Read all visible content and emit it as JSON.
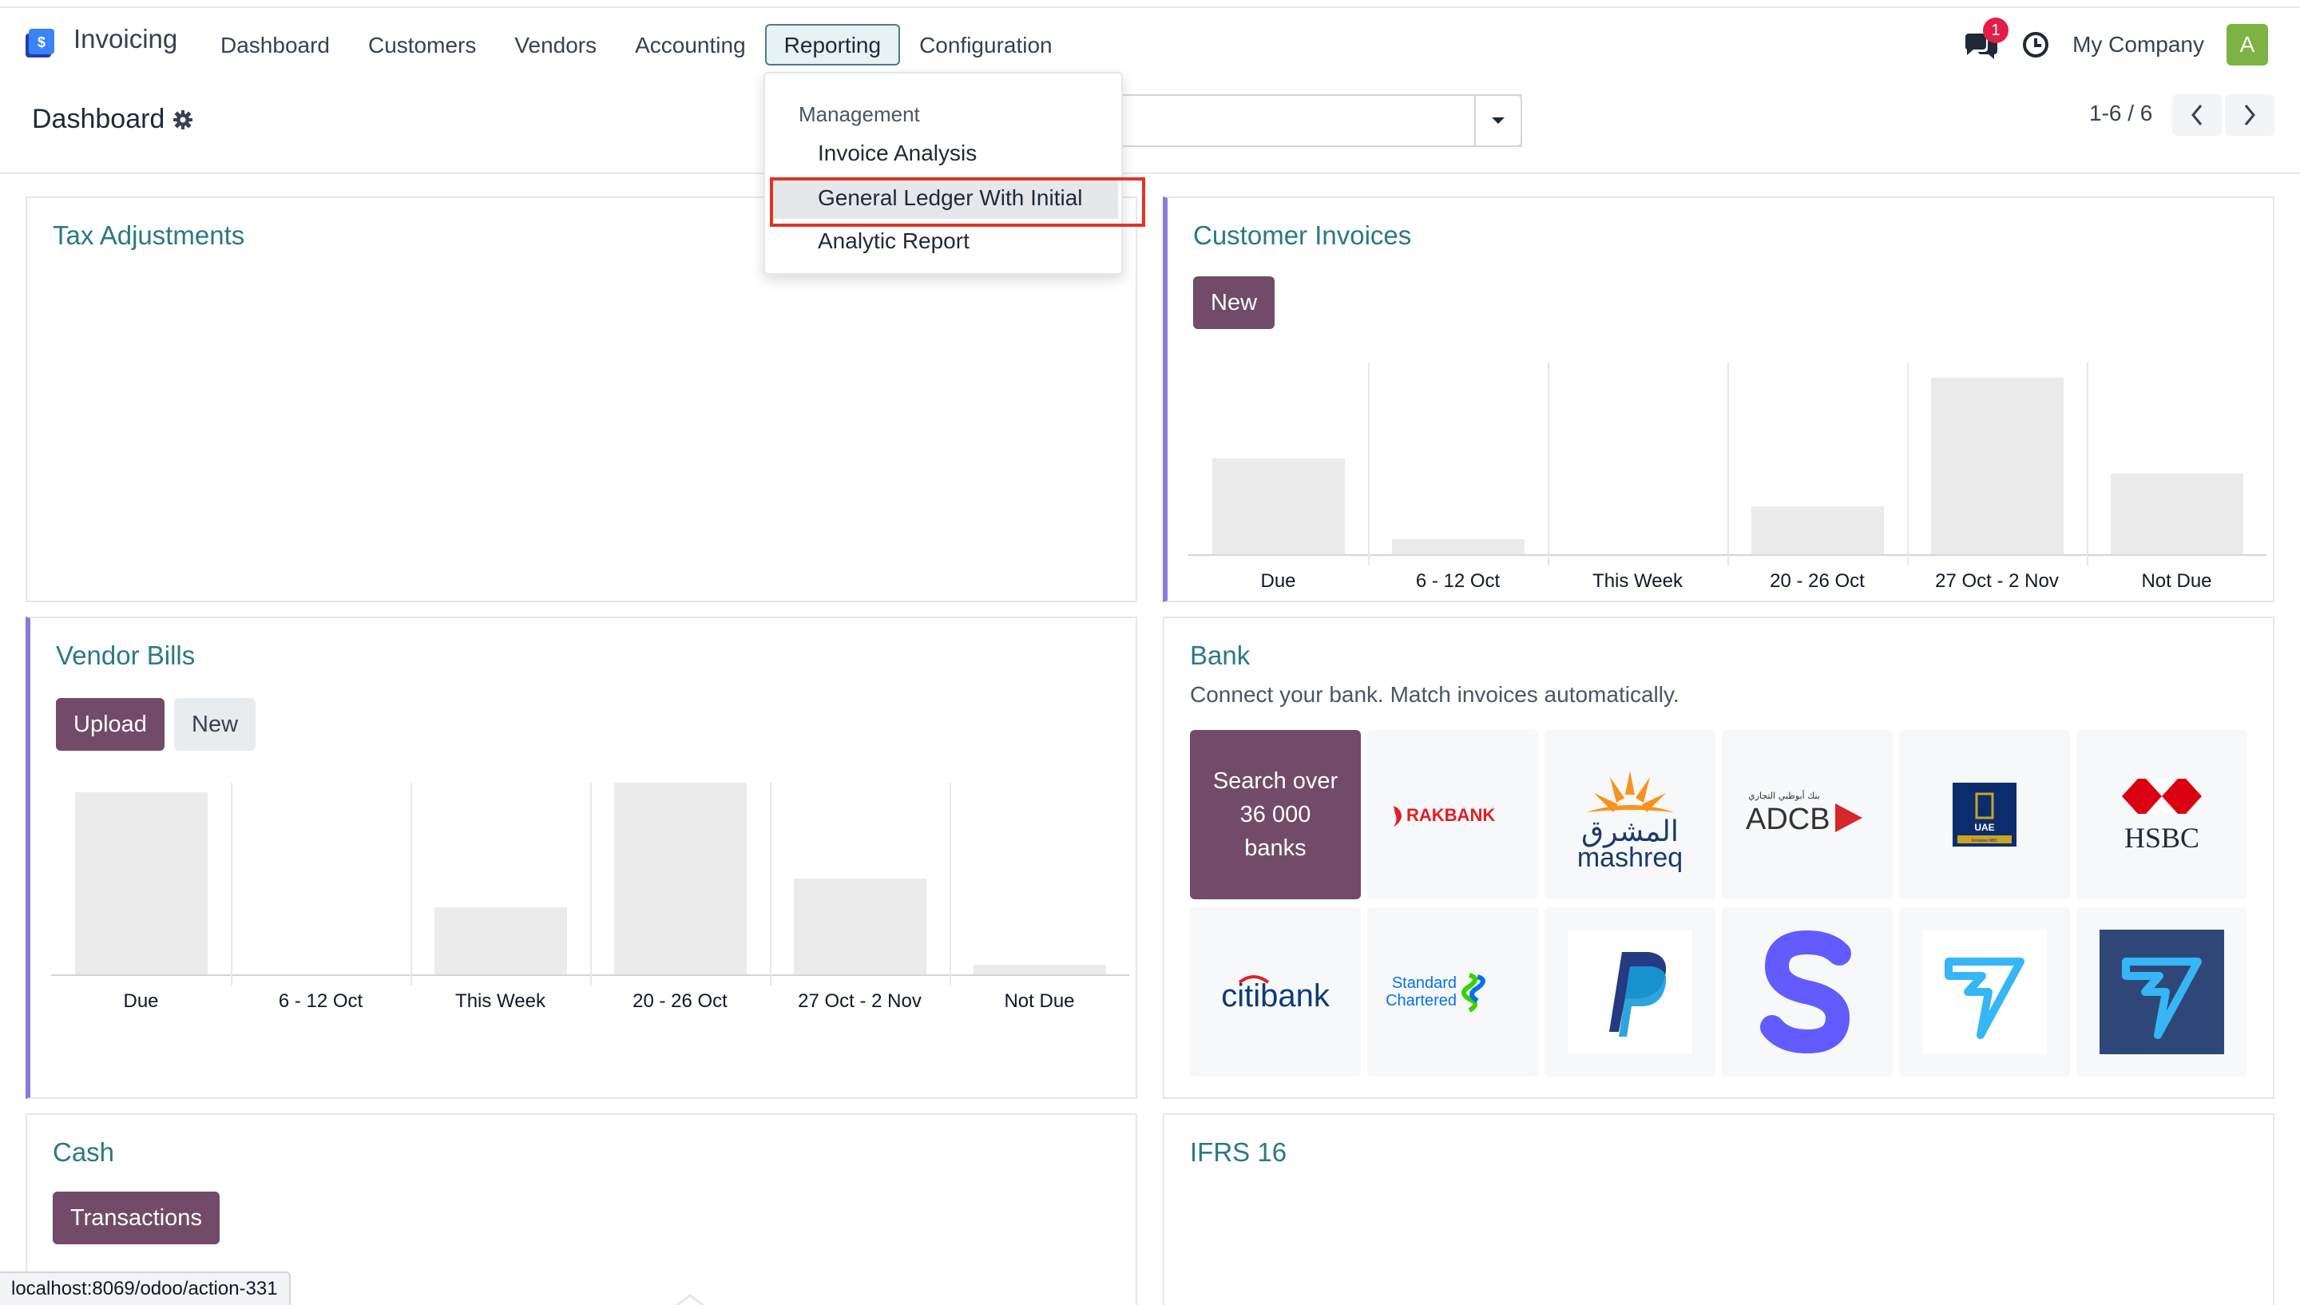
{
  "navbar": {
    "app_name": "Invoicing",
    "menu": [
      "Dashboard",
      "Customers",
      "Vendors",
      "Accounting",
      "Reporting",
      "Configuration"
    ],
    "active_menu": "Reporting",
    "notification_count": "1",
    "company": "My Company",
    "avatar_letter": "A"
  },
  "control_panel": {
    "breadcrumb": "Dashboard",
    "pager": "1-6 / 6"
  },
  "reporting_dropdown": {
    "section": "Management",
    "items": [
      "Invoice Analysis",
      "General Ledger With Initial",
      "Analytic Report"
    ],
    "highlighted": "General Ledger With Initial"
  },
  "cards": {
    "tax_adjustments": {
      "title": "Tax Adjustments"
    },
    "customer_invoices": {
      "title": "Customer Invoices",
      "new_label": "New"
    },
    "vendor_bills": {
      "title": "Vendor Bills",
      "upload_label": "Upload",
      "new_label": "New"
    },
    "bank": {
      "title": "Bank",
      "subtitle": "Connect your bank. Match invoices automatically.",
      "search_tile": [
        "Search over",
        "36 000",
        "banks"
      ],
      "logos": {
        "rakbank": "RAKBANK",
        "mashreq_arabic": "المشرق",
        "mashreq": "mashreq",
        "adcb_arabic": "بنك أبوظبي التجاري",
        "adcb": "ADCB",
        "uae": "UAE",
        "uae_small": "Emirates NBD",
        "hsbc": "HSBC",
        "citibank": "citibank",
        "standard_chartered_1": "Standard",
        "standard_chartered_2": "Chartered"
      }
    },
    "cash": {
      "title": "Cash",
      "transactions_label": "Transactions"
    },
    "ifrs16": {
      "title": "IFRS 16"
    }
  },
  "chart_data": [
    {
      "type": "bar",
      "categories": [
        "Due",
        "6 - 12 Oct",
        "This Week",
        "20 - 26 Oct",
        "27 Oct - 2 Nov",
        "Not Due"
      ],
      "values": [
        50,
        8,
        0,
        25,
        92,
        42
      ],
      "ylim": [
        0,
        100
      ],
      "grid": false
    },
    {
      "type": "bar",
      "categories": [
        "Due",
        "6 - 12 Oct",
        "This Week",
        "20 - 26 Oct",
        "27 Oct - 2 Nov",
        "Not Due"
      ],
      "values": [
        95,
        0,
        35,
        100,
        50,
        5
      ],
      "ylim": [
        0,
        100
      ],
      "grid": false
    }
  ],
  "status_bar": {
    "url": "localhost:8069/odoo/action-331"
  }
}
